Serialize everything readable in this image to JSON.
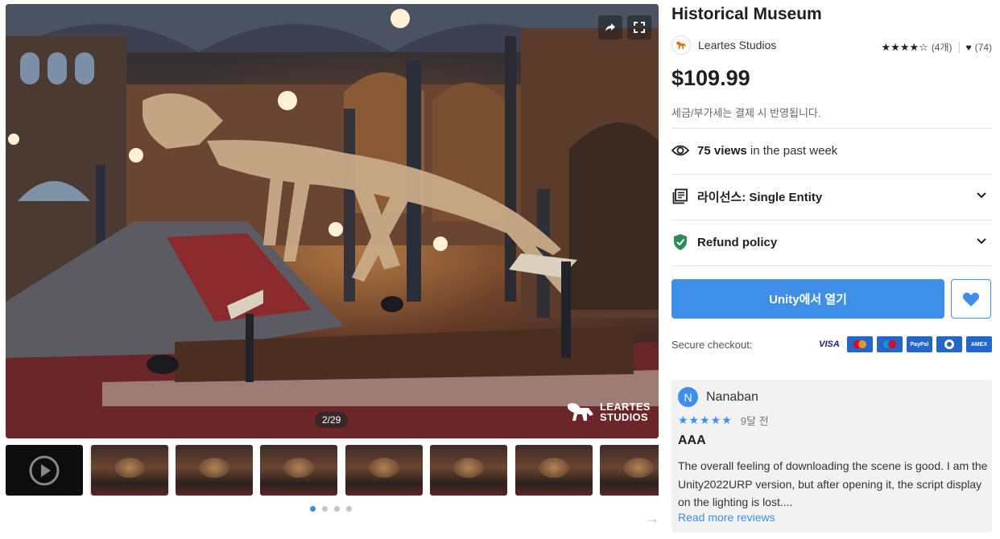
{
  "gallery": {
    "counter": "2/29",
    "brand_mark": "LEARTES\nSTUDIOS",
    "thumbnail_count": 8,
    "dots": 4,
    "active_dot": 0
  },
  "product": {
    "title": "Historical Museum",
    "publisher": "Leartes Studios",
    "stars": "★★★★☆",
    "review_count": "(4개)",
    "favorites": "(74)",
    "price": "$109.99",
    "tax_note": "세금/부가세는 결제 시 반영됩니다.",
    "views_count": "75 views",
    "views_suffix": " in the past week",
    "license": "라이선스: Single Entity",
    "refund": "Refund policy",
    "open_button": "Unity에서 열기",
    "secure_checkout": "Secure checkout:",
    "payment_methods": [
      "VISA",
      "Mastercard",
      "Maestro",
      "PayPal",
      "Diners",
      "AMEX"
    ]
  },
  "review": {
    "avatar_letter": "N",
    "name": "Nanaban",
    "stars": "★★★★★",
    "date": "9달 전",
    "title": "AAA",
    "body": "The overall feeling of downloading the scene is good. I am the Unity2022URP version, but after opening it, the script display on the lighting is lost....",
    "read_more": "Read more reviews"
  },
  "colors": {
    "accent": "#3f8fe8",
    "text": "#1f1f1f",
    "refund_shield": "#2e8b57"
  }
}
